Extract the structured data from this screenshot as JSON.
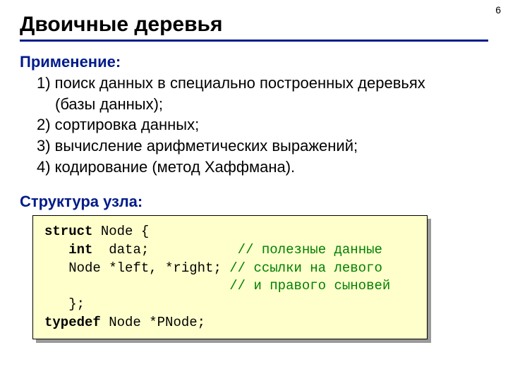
{
  "page_number": "6",
  "title": "Двоичные деревья",
  "sections": {
    "s1": {
      "label": "Применение:",
      "item1a": "1) поиск данных в специально построенных деревьях",
      "item1b": "(базы данных);",
      "item2": "2) сортировка данных;",
      "item3": "3) вычисление арифметических выражений;",
      "item4": "4) кодирование (метод Хаффмана)."
    },
    "s2": {
      "label": "Структура узла:"
    }
  },
  "code": {
    "kw_struct": "struct",
    "kw_int": "int",
    "kw_typedef": "typedef",
    "l1_rest": " Node {",
    "l2_rest": "  data;           ",
    "l2_cmt": "// полезные данные",
    "l3_pre": "   Node *left, *right; ",
    "l3_cmt": "// ссылки на левого",
    "l4_pre": "                       ",
    "l4_cmt": "// и правого сыновей",
    "l5": "   };",
    "l6_rest": " Node *PNode;"
  }
}
